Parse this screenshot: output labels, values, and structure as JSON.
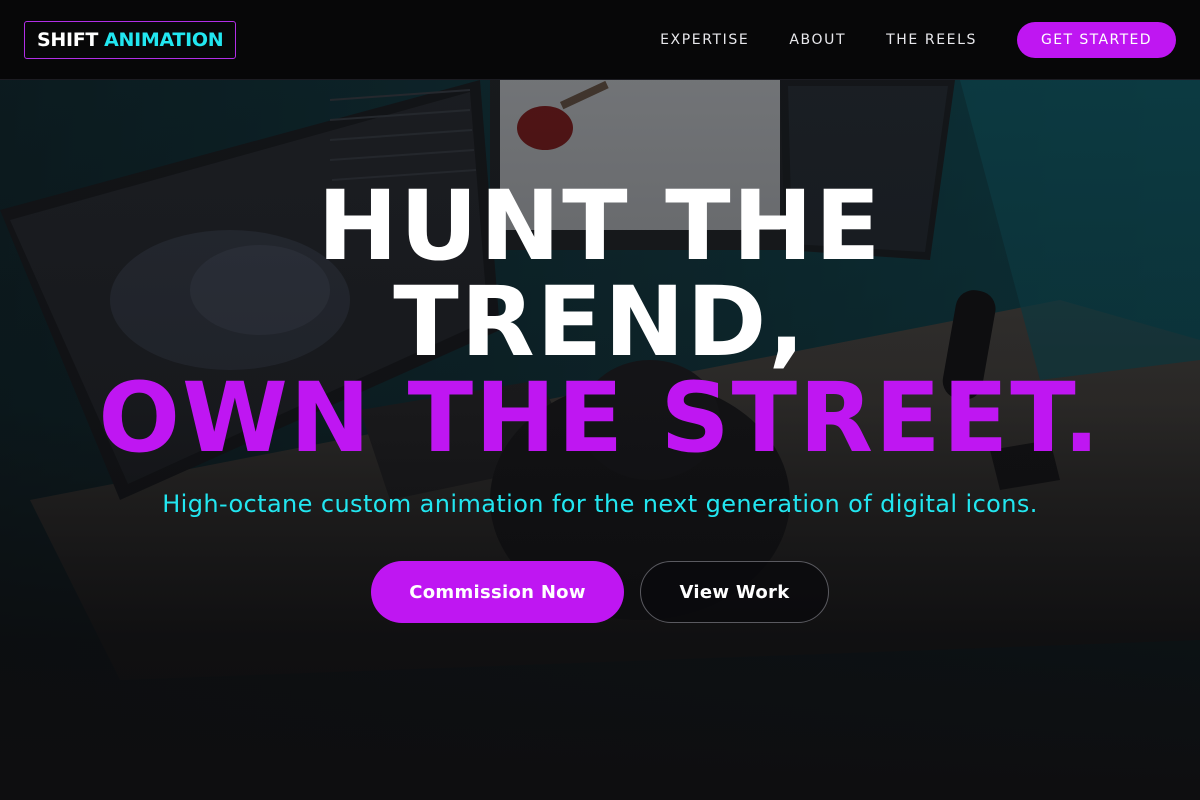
{
  "brand": {
    "name_part1": "SHIFT",
    "name_part2": "ANIMATION"
  },
  "nav": {
    "items": [
      {
        "label": "EXPERTISE"
      },
      {
        "label": "ABOUT"
      },
      {
        "label": "THE REELS"
      }
    ],
    "cta_label": "GET STARTED"
  },
  "hero": {
    "headline_line1": "HUNT THE",
    "headline_line2": "TREND,",
    "headline_line3": "OWN THE STREET.",
    "subheadline": "High-octane custom animation for the next generation of digital icons.",
    "primary_button": "Commission Now",
    "secondary_button": "View Work"
  },
  "colors": {
    "accent_purple": "#bf16f2",
    "accent_cyan": "#22e6f0",
    "background": "#0b0b0d"
  }
}
